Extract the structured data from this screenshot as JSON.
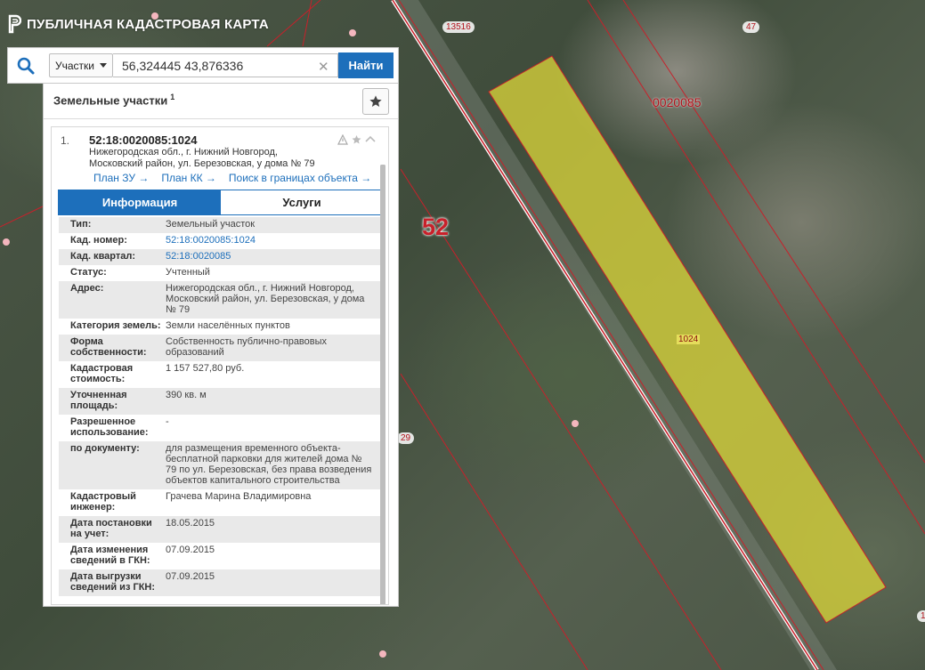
{
  "app": {
    "title": "ПУБЛИЧНАЯ КАДАСТРОВАЯ КАРТА"
  },
  "search": {
    "type_label": "Участки",
    "query": "56,324445 43,876336",
    "clear_glyph": "✕",
    "find_label": "Найти"
  },
  "panel": {
    "title": "Земельные участки",
    "count": "1"
  },
  "result": {
    "index": "1.",
    "cad_number": "52:18:0020085:1024",
    "address_line1": "Нижегородская обл., г. Нижний Новгород,",
    "address_line2": "Московский район, ул. Березовская, у дома № 79",
    "links": [
      "План ЗУ →",
      "План КК →",
      "Поиск в границах объекта →"
    ],
    "tabs": {
      "info": "Информация",
      "services": "Услуги"
    },
    "rows": [
      {
        "k": "Тип:",
        "v": "Земельный участок"
      },
      {
        "k": "Кад. номер:",
        "v": "52:18:0020085:1024",
        "link": true
      },
      {
        "k": "Кад. квартал:",
        "v": "52:18:0020085",
        "link": true
      },
      {
        "k": "Статус:",
        "v": "Учтенный"
      },
      {
        "k": "Адрес:",
        "v": "Нижегородская обл., г. Нижний Новгород, Московский район, ул. Березовская, у дома № 79"
      },
      {
        "k": "Категория земель:",
        "v": "Земли населённых пунктов"
      },
      {
        "k": "Форма собственности:",
        "v": "Собственность публично-правовых образований"
      },
      {
        "k": "Кадастровая стоимость:",
        "v": "1 157 527,80 руб."
      },
      {
        "k": "Уточненная площадь:",
        "v": "390 кв. м"
      },
      {
        "k": "Разрешенное использование:",
        "v": "-"
      },
      {
        "k": "по документу:",
        "v": "для размещения временного объекта-бесплатной парковки для жителей дома № 79 по ул. Березовская, без права возведения объектов капитального строительства"
      },
      {
        "k": "Кадастровый инженер:",
        "v": "Грачева Марина Владимировна"
      },
      {
        "k": "Дата постановки на учет:",
        "v": "18.05.2015"
      },
      {
        "k": "Дата изменения сведений в ГКН:",
        "v": "07.09.2015"
      },
      {
        "k": "Дата выгрузки сведений из ГКН:",
        "v": "07.09.2015"
      }
    ]
  },
  "map": {
    "label_52": "52",
    "label_quarter": "0020085",
    "label_parcel": "1024",
    "badge_13516": "13516",
    "badge_47": "47",
    "badge_29": "29",
    "badge_edge": "1",
    "parcel_color": "#d7d23a",
    "boundary_color": "#c8202a"
  }
}
